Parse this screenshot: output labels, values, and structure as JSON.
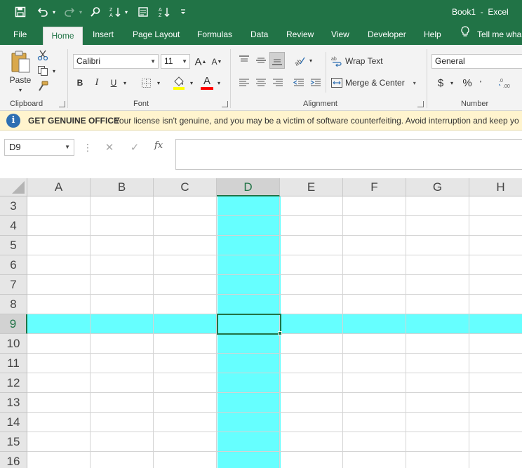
{
  "app": {
    "title": "Book1  -  Excel"
  },
  "qat": {
    "icons": [
      "save-icon",
      "undo-icon",
      "redo-icon",
      "find-icon",
      "sort-descending-icon",
      "form-icon",
      "sort-ascending-icon",
      "customize-qat-icon"
    ]
  },
  "tabs": [
    {
      "label": "File",
      "active": false
    },
    {
      "label": "Home",
      "active": true
    },
    {
      "label": "Insert",
      "active": false
    },
    {
      "label": "Page Layout",
      "active": false
    },
    {
      "label": "Formulas",
      "active": false
    },
    {
      "label": "Data",
      "active": false
    },
    {
      "label": "Review",
      "active": false
    },
    {
      "label": "View",
      "active": false
    },
    {
      "label": "Developer",
      "active": false
    },
    {
      "label": "Help",
      "active": false
    }
  ],
  "tell_me": {
    "label": "Tell me wha"
  },
  "ribbon": {
    "clipboard": {
      "label": "Clipboard",
      "paste_label": "Paste"
    },
    "font": {
      "label": "Font",
      "font_name": "Calibri",
      "font_size": "11",
      "bold": "B",
      "italic": "I",
      "underline": "U",
      "grow": "A",
      "shrink": "A",
      "font_color_glyph": "A",
      "highlight_color": "#ffff00",
      "font_color": "#ff0000"
    },
    "alignment": {
      "label": "Alignment",
      "wrap_text": "Wrap Text",
      "merge_center": "Merge & Center"
    },
    "number": {
      "label": "Number",
      "format": "General",
      "currency": "$",
      "percent": "%"
    }
  },
  "message_bar": {
    "title": "GET GENUINE OFFICE",
    "text": "Your license isn't genuine, and you may be a victim of software counterfeiting. Avoid interruption and keep yo"
  },
  "formula_bar": {
    "name_box": "D9",
    "cancel_glyph": "✕",
    "enter_glyph": "✓",
    "fx_label": "fx",
    "formula": ""
  },
  "sheet": {
    "columns": [
      "A",
      "B",
      "C",
      "D",
      "E",
      "F",
      "G",
      "H"
    ],
    "rows": [
      "3",
      "4",
      "5",
      "6",
      "7",
      "8",
      "9",
      "10",
      "11",
      "12",
      "13",
      "14",
      "15",
      "16"
    ],
    "selected_column": "D",
    "selected_row": "9",
    "highlight_color": "#66ffff",
    "accent_color": "#217346"
  }
}
